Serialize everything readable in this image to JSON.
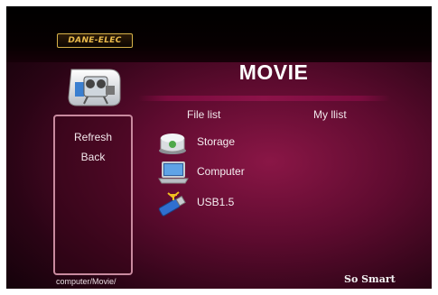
{
  "brand": {
    "logo_text": "DANE-ELEC",
    "tagline": "So Smart"
  },
  "header": {
    "title": "MOVIE",
    "app_icon": "movie-camera-icon"
  },
  "tabs": [
    {
      "label": "File list",
      "selected": true
    },
    {
      "label": "My llist",
      "selected": false
    }
  ],
  "sidebar": {
    "items": [
      {
        "label": "Refresh"
      },
      {
        "label": "Back"
      }
    ]
  },
  "file_list": {
    "items": [
      {
        "label": "Storage",
        "icon": "storage-drive-icon"
      },
      {
        "label": "Computer",
        "icon": "laptop-icon"
      },
      {
        "label": "USB1.5",
        "icon": "usb-drive-icon"
      }
    ]
  },
  "status": {
    "path": "computer/Movie/"
  },
  "colors": {
    "background": "#5e0b2f",
    "accent": "#8c1349",
    "logo_gold": "#e9bb4c",
    "panel_border": "#c98a9f"
  }
}
